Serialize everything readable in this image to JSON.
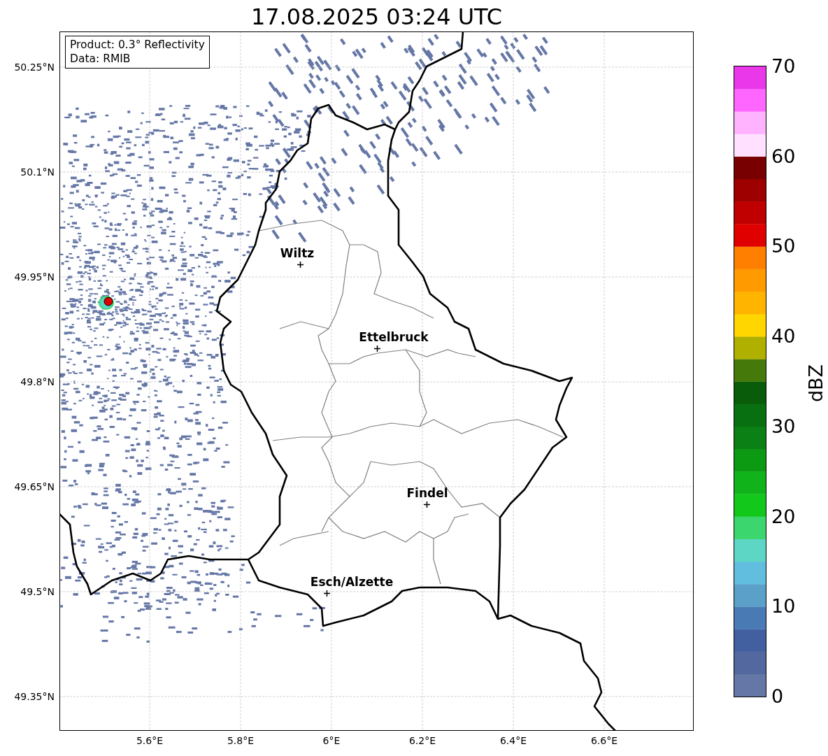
{
  "title": "17.08.2025 03:24 UTC",
  "info_box": {
    "lines": [
      "Product: 0.3° Reflectivity",
      "Data: RMIB"
    ]
  },
  "map": {
    "x_tick_labels": [
      "5.6°E",
      "5.8°E",
      "6°E",
      "6.2°E",
      "6.4°E",
      "6.6°E"
    ],
    "y_tick_labels": [
      "50.25°N",
      "50.1°N",
      "49.95°N",
      "49.8°N",
      "49.65°N",
      "49.5°N",
      "49.35°N"
    ],
    "cities": [
      {
        "name": "Wiltz"
      },
      {
        "name": "Ettelbruck"
      },
      {
        "name": "Findel"
      },
      {
        "name": "Esch/Alzette"
      }
    ]
  },
  "colorbar": {
    "label": "dBZ",
    "tick_labels": [
      "70",
      "60",
      "50",
      "40",
      "30",
      "20",
      "10",
      "0"
    ],
    "bins": [
      {
        "color": "#6577a6"
      },
      {
        "color": "#52689e"
      },
      {
        "color": "#4260a0"
      },
      {
        "color": "#4a7ab4"
      },
      {
        "color": "#5aa0c8"
      },
      {
        "color": "#62bede"
      },
      {
        "color": "#5ed6c6"
      },
      {
        "color": "#3cd66e"
      },
      {
        "color": "#12c81a"
      },
      {
        "color": "#10b41a"
      },
      {
        "color": "#0c9a12"
      },
      {
        "color": "#0a8015"
      },
      {
        "color": "#087010"
      },
      {
        "color": "#085c0a"
      },
      {
        "color": "#457a0a"
      },
      {
        "color": "#b0b000"
      },
      {
        "color": "#ffd600"
      },
      {
        "color": "#ffb400"
      },
      {
        "color": "#ff9a00"
      },
      {
        "color": "#ff7f00"
      },
      {
        "color": "#e00000"
      },
      {
        "color": "#c00000"
      },
      {
        "color": "#9e0000"
      },
      {
        "color": "#780000"
      },
      {
        "color": "#ffe0ff"
      },
      {
        "color": "#ffb3ff"
      },
      {
        "color": "#ff66ff"
      },
      {
        "color": "#ea37ea"
      }
    ]
  }
}
